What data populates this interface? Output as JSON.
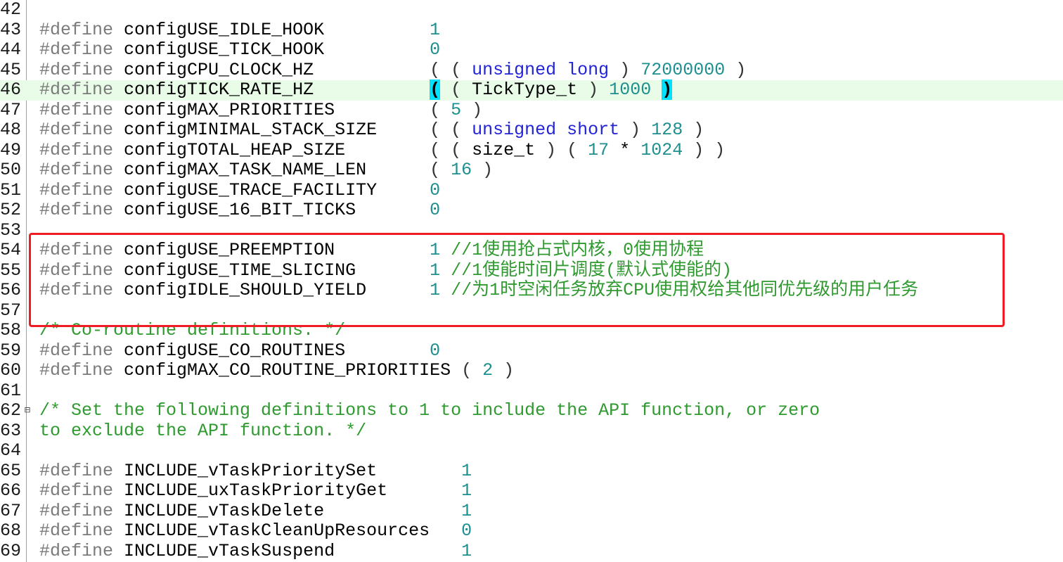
{
  "editor": {
    "lines": [
      {
        "n": "42",
        "parts": []
      },
      {
        "n": "43",
        "parts": [
          [
            "pp",
            "#define "
          ],
          [
            "id",
            "configUSE_IDLE_HOOK          "
          ],
          [
            "num",
            "1"
          ]
        ]
      },
      {
        "n": "44",
        "parts": [
          [
            "pp",
            "#define "
          ],
          [
            "id",
            "configUSE_TICK_HOOK          "
          ],
          [
            "num",
            "0"
          ]
        ]
      },
      {
        "n": "45",
        "parts": [
          [
            "pp",
            "#define "
          ],
          [
            "id",
            "configCPU_CLOCK_HZ           "
          ],
          [
            "br",
            "( ( "
          ],
          [
            "kw",
            "unsigned long"
          ],
          [
            "br",
            " ) "
          ],
          [
            "num",
            "72000000"
          ],
          [
            "br",
            " )"
          ]
        ]
      },
      {
        "n": "46",
        "hl": true,
        "parts": [
          [
            "pp",
            "#define "
          ],
          [
            "id",
            "configTICK_RATE_HZ           "
          ],
          [
            "brm",
            "("
          ],
          [
            "br",
            " ( "
          ],
          [
            "id",
            "TickType_t"
          ],
          [
            "br",
            " ) "
          ],
          [
            "num",
            "1000"
          ],
          [
            "br",
            " "
          ],
          [
            "brm",
            ")"
          ]
        ]
      },
      {
        "n": "47",
        "parts": [
          [
            "pp",
            "#define "
          ],
          [
            "id",
            "configMAX_PRIORITIES         "
          ],
          [
            "br",
            "( "
          ],
          [
            "num",
            "5"
          ],
          [
            "br",
            " )"
          ]
        ]
      },
      {
        "n": "48",
        "parts": [
          [
            "pp",
            "#define "
          ],
          [
            "id",
            "configMINIMAL_STACK_SIZE     "
          ],
          [
            "br",
            "( ( "
          ],
          [
            "kw",
            "unsigned short"
          ],
          [
            "br",
            " ) "
          ],
          [
            "num",
            "128"
          ],
          [
            "br",
            " )"
          ]
        ]
      },
      {
        "n": "49",
        "parts": [
          [
            "pp",
            "#define "
          ],
          [
            "id",
            "configTOTAL_HEAP_SIZE        "
          ],
          [
            "br",
            "( ( "
          ],
          [
            "id",
            "size_t"
          ],
          [
            "br",
            " ) ( "
          ],
          [
            "num",
            "17"
          ],
          [
            "id",
            " * "
          ],
          [
            "num",
            "1024"
          ],
          [
            "br",
            " ) )"
          ]
        ]
      },
      {
        "n": "50",
        "parts": [
          [
            "pp",
            "#define "
          ],
          [
            "id",
            "configMAX_TASK_NAME_LEN      "
          ],
          [
            "br",
            "( "
          ],
          [
            "num",
            "16"
          ],
          [
            "br",
            " )"
          ]
        ]
      },
      {
        "n": "51",
        "parts": [
          [
            "pp",
            "#define "
          ],
          [
            "id",
            "configUSE_TRACE_FACILITY     "
          ],
          [
            "num",
            "0"
          ]
        ]
      },
      {
        "n": "52",
        "parts": [
          [
            "pp",
            "#define "
          ],
          [
            "id",
            "configUSE_16_BIT_TICKS       "
          ],
          [
            "num",
            "0"
          ]
        ]
      },
      {
        "n": "53",
        "parts": []
      },
      {
        "n": "54",
        "parts": [
          [
            "pp",
            "#define "
          ],
          [
            "id",
            "configUSE_PREEMPTION         "
          ],
          [
            "num",
            "1"
          ],
          [
            "cm",
            " //1使用抢占式内核，0使用协程"
          ]
        ]
      },
      {
        "n": "55",
        "parts": [
          [
            "pp",
            "#define "
          ],
          [
            "id",
            "configUSE_TIME_SLICING       "
          ],
          [
            "num",
            "1"
          ],
          [
            "cm",
            " //1使能时间片调度(默认式使能的)"
          ]
        ]
      },
      {
        "n": "56",
        "parts": [
          [
            "pp",
            "#define "
          ],
          [
            "id",
            "configIDLE_SHOULD_YIELD      "
          ],
          [
            "num",
            "1"
          ],
          [
            "cm",
            " //为1时空闲任务放弃CPU使用权给其他同优先级的用户任务"
          ]
        ]
      },
      {
        "n": "57",
        "parts": []
      },
      {
        "n": "58",
        "parts": [
          [
            "cm",
            "/* Co-routine definitions. */"
          ]
        ]
      },
      {
        "n": "59",
        "parts": [
          [
            "pp",
            "#define "
          ],
          [
            "id",
            "configUSE_CO_ROUTINES        "
          ],
          [
            "num",
            "0"
          ]
        ]
      },
      {
        "n": "60",
        "parts": [
          [
            "pp",
            "#define "
          ],
          [
            "id",
            "configMAX_CO_ROUTINE_PRIORITIES "
          ],
          [
            "br",
            "( "
          ],
          [
            "num",
            "2"
          ],
          [
            "br",
            " )"
          ]
        ]
      },
      {
        "n": "61",
        "parts": []
      },
      {
        "n": "62",
        "fold": "⊟",
        "parts": [
          [
            "cm",
            "/* Set the following definitions to 1 to include the API function, or zero"
          ]
        ]
      },
      {
        "n": "63",
        "parts": [
          [
            "cm",
            "to exclude the API function. */"
          ]
        ]
      },
      {
        "n": "64",
        "parts": []
      },
      {
        "n": "65",
        "parts": [
          [
            "pp",
            "#define "
          ],
          [
            "id",
            "INCLUDE_vTaskPrioritySet        "
          ],
          [
            "num",
            "1"
          ]
        ]
      },
      {
        "n": "66",
        "parts": [
          [
            "pp",
            "#define "
          ],
          [
            "id",
            "INCLUDE_uxTaskPriorityGet       "
          ],
          [
            "num",
            "1"
          ]
        ]
      },
      {
        "n": "67",
        "parts": [
          [
            "pp",
            "#define "
          ],
          [
            "id",
            "INCLUDE_vTaskDelete             "
          ],
          [
            "num",
            "1"
          ]
        ]
      },
      {
        "n": "68",
        "parts": [
          [
            "pp",
            "#define "
          ],
          [
            "id",
            "INCLUDE_vTaskCleanUpResources   "
          ],
          [
            "num",
            "0"
          ]
        ]
      },
      {
        "n": "69",
        "parts": [
          [
            "pp",
            "#define "
          ],
          [
            "id",
            "INCLUDE_vTaskSuspend            "
          ],
          [
            "num",
            "1"
          ]
        ]
      }
    ],
    "highlight_box_color": "#ef1c24",
    "current_line_color": "#e8fce8"
  }
}
